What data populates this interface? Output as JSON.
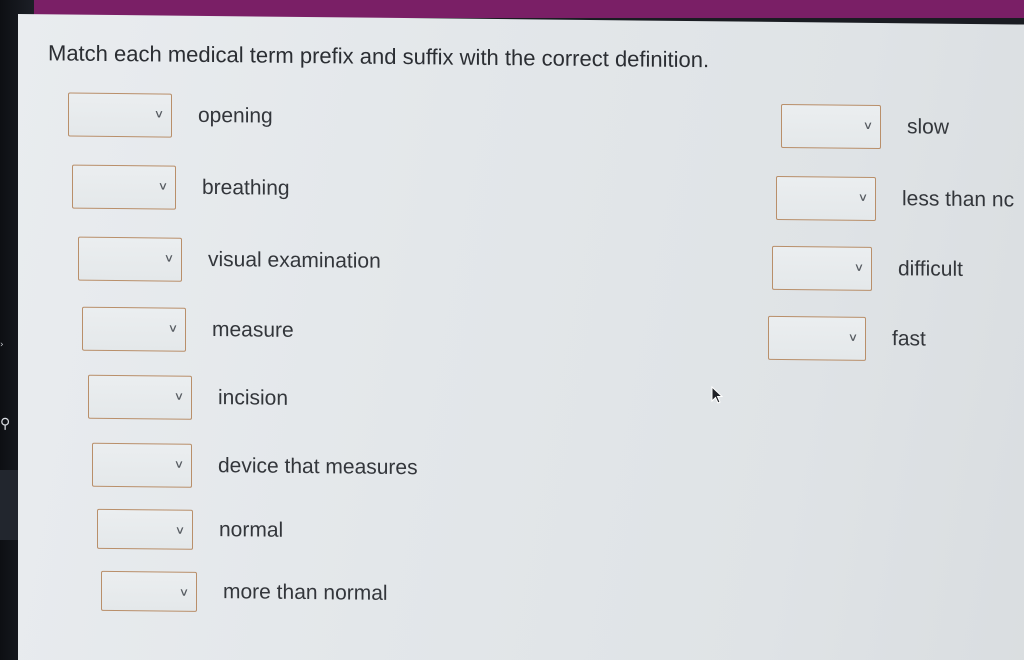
{
  "question": {
    "title": "Match each medical term prefix and suffix with the correct definition."
  },
  "left_items": [
    {
      "label": "opening"
    },
    {
      "label": "breathing"
    },
    {
      "label": "visual examination"
    },
    {
      "label": "measure"
    },
    {
      "label": "incision"
    },
    {
      "label": "device that measures"
    },
    {
      "label": "normal"
    },
    {
      "label": "more than normal"
    }
  ],
  "right_items": [
    {
      "label": "slow"
    },
    {
      "label": "less than nc"
    },
    {
      "label": "difficult"
    },
    {
      "label": "fast"
    }
  ],
  "dropdown": {
    "chevron_icon": "chevron-down-icon",
    "selected_value": ""
  },
  "colors": {
    "top_bar": "#7a1f66",
    "select_border": "#b98f6a",
    "text": "#33363b"
  }
}
